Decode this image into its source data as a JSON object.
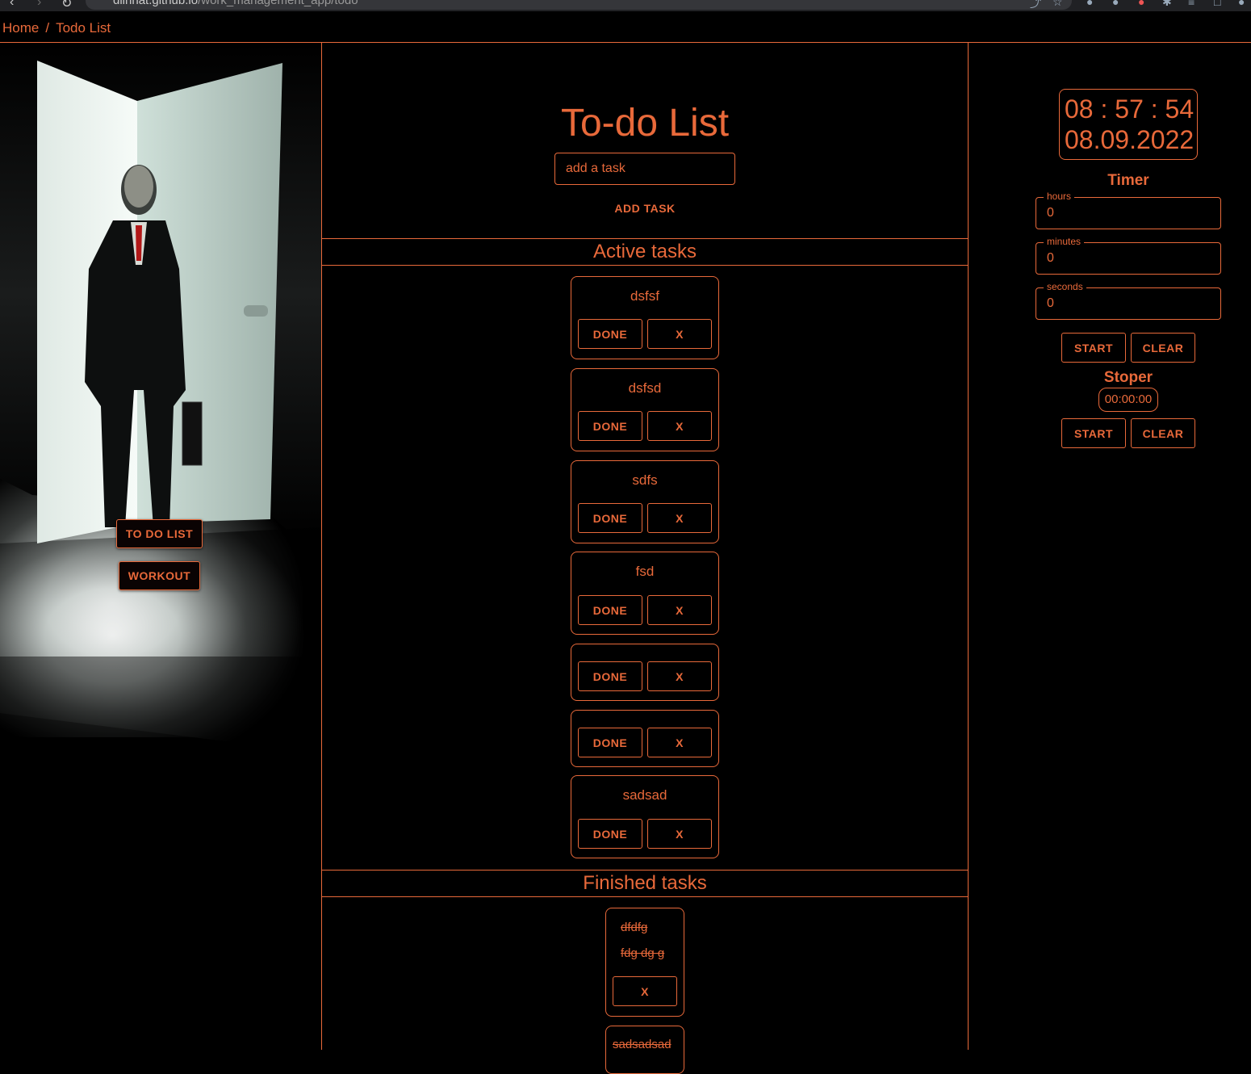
{
  "browser": {
    "url_host": "dlinhat.github.io",
    "url_path": "/work_management_app/todo"
  },
  "breadcrumb": {
    "home": "Home",
    "separator": "/",
    "current": "Todo List"
  },
  "sidebar": {
    "todo_button": "TO DO LIST",
    "workout_button": "WORKOUT"
  },
  "todo": {
    "title": "To-do List",
    "input_placeholder": "add a task",
    "add_button": "ADD TASK",
    "active_header": "Active tasks",
    "finished_header": "Finished tasks",
    "done_label": "DONE",
    "remove_label": "X",
    "active_tasks": [
      {
        "name": "dsfsf"
      },
      {
        "name": "dsfsd"
      },
      {
        "name": "sdfs"
      },
      {
        "name": "fsd"
      },
      {
        "name": ""
      },
      {
        "name": ""
      },
      {
        "name": "sadsad"
      }
    ],
    "finished_tasks": [
      {
        "lines": [
          "dfdfg",
          "fdg dg g"
        ]
      },
      {
        "lines": [
          "sadsadsad"
        ]
      }
    ]
  },
  "clock": {
    "time": "08 : 57 : 54",
    "date": "08.09.2022"
  },
  "timer": {
    "title": "Timer",
    "hours_label": "hours",
    "hours_value": "0",
    "minutes_label": "minutes",
    "minutes_value": "0",
    "seconds_label": "seconds",
    "seconds_value": "0",
    "start_button": "START",
    "clear_button": "CLEAR"
  },
  "stoper": {
    "title": "Stoper",
    "display": "00:00:00",
    "start_button": "START",
    "clear_button": "CLEAR"
  },
  "colors": {
    "accent": "#e8693a",
    "background": "#000000"
  }
}
